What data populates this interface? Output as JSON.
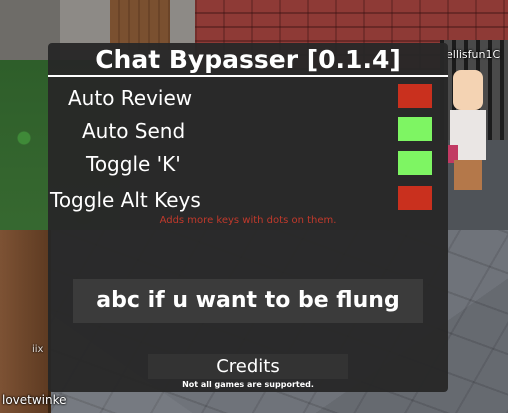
{
  "world": {
    "player_tag_top": "ellisfun1C",
    "player_tag_bottom": "lovetwinke",
    "player_tag_left": "iix"
  },
  "panel": {
    "title": "Chat Bypasser [0.1.4]",
    "options": [
      {
        "label": "Auto Review",
        "enabled": false
      },
      {
        "label": "Auto Send",
        "enabled": true
      },
      {
        "label": "Toggle 'K'",
        "enabled": true
      },
      {
        "label": "Toggle Alt Keys",
        "enabled": false
      }
    ],
    "alt_keys_hint": "Adds more keys with dots on them.",
    "phrase_text": "abc if u want to be flung",
    "credits_label": "Credits",
    "footnote": "Not all games are supported."
  },
  "colors": {
    "toggle_on": "#7ef563",
    "toggle_off": "#c9301e",
    "hint": "#c0392b",
    "panel_bg": "#282828"
  }
}
